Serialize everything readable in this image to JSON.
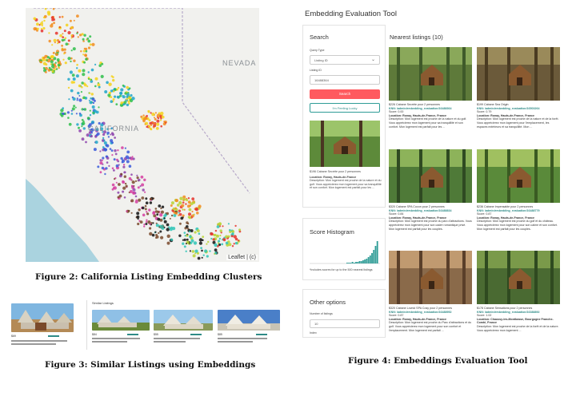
{
  "figure2": {
    "caption": "Figure 2: California Listing Embedding Clusters",
    "labels": {
      "nevada": "NEVADA",
      "california": "CALIFORNIA"
    },
    "attribution": "Leaflet | (c)",
    "cluster_colors": [
      "#e6332a",
      "#f28c1e",
      "#f5d21a",
      "#2fbf4a",
      "#1fa6c9",
      "#3b5bd9",
      "#8e44ad",
      "#d53ea0",
      "#7a4a2b",
      "#111111",
      "#2ec4b6",
      "#b8d432"
    ]
  },
  "figure3": {
    "caption": "Figure 3: Similar Listings using Embeddings",
    "similar_title": "Similar Listings",
    "query_price": "$69",
    "cards": [
      {
        "price": "$84"
      },
      {
        "price": "$55"
      },
      {
        "price": "$85"
      }
    ]
  },
  "figure4": {
    "caption": "Figure 4: Embeddings Evaluation Tool",
    "title": "Embedding Evaluation Tool",
    "search": {
      "title": "Search",
      "query_type_label": "Query Type",
      "query_type_value": "Listing ID",
      "listing_id_label": "Listing ID",
      "listing_id_value": "16488364",
      "search_button": "Search",
      "lucky_button": "I'm Feeling Lucky",
      "query_listing": {
        "title": "$196 Cabane Secrète pour 2 personnes",
        "location": "Location: Ronay, Hauts-de-France",
        "description": "Description: Mon logement est proche de la nature et du golf. Vous apprécierez mon logement pour sa tranquillité et son confort. Mon logement est parfait pour les ..."
      }
    },
    "histogram": {
      "title": "Score Histogram",
      "note": "*Includes scores for up to the 500 nearest listings",
      "bars": [
        1,
        1,
        1,
        2,
        1,
        2,
        2,
        3,
        3,
        4,
        5,
        6,
        8,
        10,
        13,
        17,
        22,
        28
      ]
    },
    "other": {
      "title": "Other options",
      "number_label": "Number of listings",
      "number_value": "10",
      "index_label": "Index"
    },
    "nearest_title": "Nearest listings (10)",
    "listings": [
      {
        "title": "$226 Cabane Secrète pour 2 personnes",
        "knn": "KNN: /admin/embedding_evaluation/16488364",
        "score": "Score: 0.00",
        "location": "Location: Ronay, Hauts-de-France, France",
        "description": "Description: Mon logement est proche de la nature et du golf. Vous apprécierez mon logement pour sa tranquillité et son confort. Mon logement est parfait pour les ...",
        "palette": [
          "#5e7a3a",
          "#8aa85a",
          "#3f5a2a"
        ]
      },
      {
        "title": "$199 Cabane Sea Origin",
        "knn": "KNN: /admin/embedding_evaluation/16503264",
        "score": "Score: 0.79",
        "location": "Location: Ronay, Hauts-de-France, France",
        "description": "Description: Mon logement est proche de la nature et de la forêt. Vous apprécierez mon logement pour l'emplacement, les espaces extérieurs et sa tranquillité. Mon ...",
        "palette": [
          "#6b5a3a",
          "#9a8a5a",
          "#4a3b22"
        ]
      },
      {
        "title": "$320 Cabane SPA Cocon pour 2 personnes",
        "knn": "KNN: /admin/embedding_evaluation/16488834",
        "score": "Score: 0.84",
        "location": "Location: Ronay, Hauts-de-France, France",
        "description": "Description: Mon logement est proche du parc d'attractions. Vous apprécierez mon logement pour son cadre romantique privé. Mon logement est parfait pour les couples.",
        "palette": [
          "#4f7a38",
          "#8db35a",
          "#2f4a22"
        ]
      },
      {
        "title": "$236 Cabane Impensable pour 2 personnes",
        "knn": "KNN: /admin/embedding_evaluation/16488779",
        "score": "Score: 0.87",
        "location": "Location: Ronay, Hauts-de-France, France",
        "description": "Description: Mon logement est proche du golf et du château. Vous apprécierez mon logement pour son calme et son confort. Mon logement est parfait pour les couples.",
        "palette": [
          "#5a8a3a",
          "#a0c060",
          "#3a5a22"
        ]
      },
      {
        "title": "$320 Cabane Lovnid SPA Cosy pour 2 personnes",
        "knn": "KNN: /admin/embedding_evaluation/16488952",
        "score": "Score: 0.87",
        "location": "Location: Ronay, Hauts-de-France, France",
        "description": "Description: Mon logement est proche du Parc d'attractions et du golf. Vous apprécierez mon logement pour son confort et l'emplacement. Mon logement est parfait ...",
        "palette": [
          "#8a6a4a",
          "#c09a70",
          "#5a3f2a"
        ]
      },
      {
        "title": "$178 Cabane Sensations pour 2 personnes",
        "knn": "KNN: /admin/embedding_evaluation/16388892",
        "score": "Score: 1.02",
        "location": "Location: Chaussy-les-Montbasse, Bourgogne Franche-Comté, France",
        "description": "Description: Mon logement est proche de la forêt et de la nature. Vous apprécierez mon logement ...",
        "palette": [
          "#4a6a32",
          "#7a9a4a",
          "#2f4a20"
        ]
      }
    ]
  }
}
